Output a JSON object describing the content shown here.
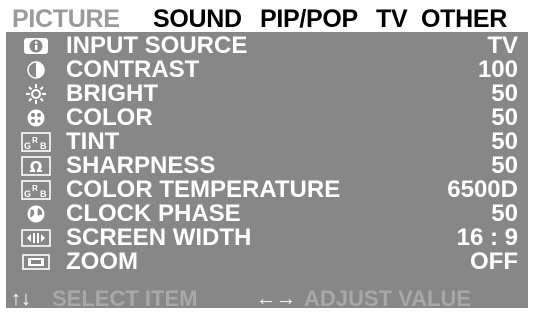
{
  "tabs": [
    {
      "label": "PICTURE",
      "active": true
    },
    {
      "label": "SOUND",
      "active": false
    },
    {
      "label": "PIP/POP",
      "active": false
    },
    {
      "label": "TV",
      "active": false
    },
    {
      "label": "OTHER",
      "active": false
    }
  ],
  "menu": [
    {
      "label": "INPUT SOURCE",
      "value": "TV",
      "icon": "info-icon"
    },
    {
      "label": "CONTRAST",
      "value": "100",
      "icon": "contrast-icon"
    },
    {
      "label": "BRIGHT",
      "value": "50",
      "icon": "brightness-sun-icon"
    },
    {
      "label": "COLOR",
      "value": "50",
      "icon": "color-palette-icon"
    },
    {
      "label": "TINT",
      "value": "50",
      "icon": "grb-tint-icon"
    },
    {
      "label": "SHARPNESS",
      "value": "50",
      "icon": "sharpness-omega-icon"
    },
    {
      "label": "COLOR TEMPERATURE",
      "value": "6500D",
      "icon": "grb-color-temperature-icon"
    },
    {
      "label": "CLOCK PHASE",
      "value": "50",
      "icon": "clock-phase-globe-icon"
    },
    {
      "label": "SCREEN WIDTH",
      "value": "16 : 9",
      "icon": "screen-width-icon"
    },
    {
      "label": "ZOOM",
      "value": "OFF",
      "icon": "zoom-screen-icon"
    }
  ],
  "footer": {
    "select_arrows": "↑↓",
    "select_text": "SELECT ITEM",
    "adjust_arrows": "←→",
    "adjust_text": "ADJUST VALUE"
  },
  "colors": {
    "panel_background": "#878787",
    "tab_bar_background": "#ffffff",
    "active_tab": "#9a9a9a",
    "inactive_tab": "#000000",
    "menu_text": "#ffffff",
    "footer_text": "#a8a8a8"
  }
}
